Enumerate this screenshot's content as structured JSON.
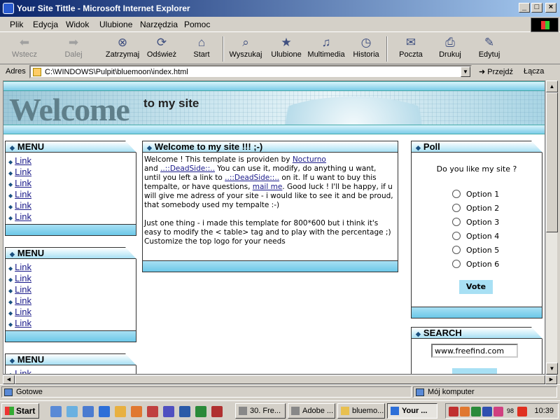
{
  "window": {
    "title": "Your Site Tittle - Microsoft Internet Explorer"
  },
  "menu": [
    "Plik",
    "Edycja",
    "Widok",
    "Ulubione",
    "Narzędzia",
    "Pomoc"
  ],
  "toolbar": {
    "buttons": [
      {
        "label": "Wstecz",
        "icon": "back-arrow-icon",
        "enabled": false
      },
      {
        "label": "Dalej",
        "icon": "forward-arrow-icon",
        "enabled": false
      },
      {
        "label": "Zatrzymaj",
        "icon": "stop-icon",
        "enabled": true
      },
      {
        "label": "Odśwież",
        "icon": "refresh-icon",
        "enabled": true
      },
      {
        "label": "Start",
        "icon": "home-icon",
        "enabled": true
      },
      {
        "label": "Wyszukaj",
        "icon": "search-icon",
        "enabled": true
      },
      {
        "label": "Ulubione",
        "icon": "favorites-icon",
        "enabled": true
      },
      {
        "label": "Multimedia",
        "icon": "media-icon",
        "enabled": true
      },
      {
        "label": "Historia",
        "icon": "history-icon",
        "enabled": true
      },
      {
        "label": "Poczta",
        "icon": "mail-icon",
        "enabled": true
      },
      {
        "label": "Drukuj",
        "icon": "print-icon",
        "enabled": true
      },
      {
        "label": "Edytuj",
        "icon": "edit-icon",
        "enabled": true
      }
    ]
  },
  "address": {
    "label": "Adres",
    "value": "C:\\WINDOWS\\Pulpit\\bluemoon\\index.html",
    "go": "Przejdź",
    "links": "Łącza"
  },
  "page": {
    "banner": {
      "welcome": "Welcome",
      "subtitle": "to my site"
    },
    "menus": [
      {
        "title": "MENU",
        "links": [
          "Link",
          "Link",
          "Link",
          "Link",
          "Link",
          "Link"
        ]
      },
      {
        "title": "MENU",
        "links": [
          "Link",
          "Link",
          "Link",
          "Link",
          "Link",
          "Link"
        ]
      },
      {
        "title": "MENU",
        "links": [
          "Link"
        ]
      }
    ],
    "content": {
      "title": "Welcome to my site !!! ;-)",
      "p1": "Welcome ! This template is providen by ",
      "author": "Nocturno",
      "p2": "and ",
      "dead1": "..::DeadSide::..",
      "p3": " You can use it, modify, do anything u want, until you left a link to ",
      "dead2": "..::DeadSide::..",
      "p4": " on it. If u want to buy this tempalte, or have questions, ",
      "mail": "mail me",
      "p5": ". Good luck ! I'll be happy, if u will give me adress of your site - i would like to see it and be proud, that somebody used my tempalte :-)",
      "p6": "Just one thing - i made this template for 800*600 but i think it's easy to modify the < table> tag and to play with the percentage ;)",
      "p7": "Customize the top logo for your needs"
    },
    "poll": {
      "title": "Poll",
      "question": "Do you like my site ?",
      "options": [
        "Option 1",
        "Option 2",
        "Option 3",
        "Option 4",
        "Option 5",
        "Option 6"
      ],
      "vote": "Vote"
    },
    "search": {
      "title": "SEARCH",
      "value": "www.freefind.com"
    }
  },
  "status": {
    "text": "Gotowe",
    "zone": "Mój komputer"
  },
  "taskbar": {
    "start": "Start",
    "tasks": [
      {
        "label": "30. Fre...",
        "active": false
      },
      {
        "label": "Adobe ...",
        "active": false
      },
      {
        "label": "bluemo...",
        "active": false
      },
      {
        "label": "Your ...",
        "active": true
      }
    ],
    "tray_number": "98",
    "clock": "10:39"
  }
}
